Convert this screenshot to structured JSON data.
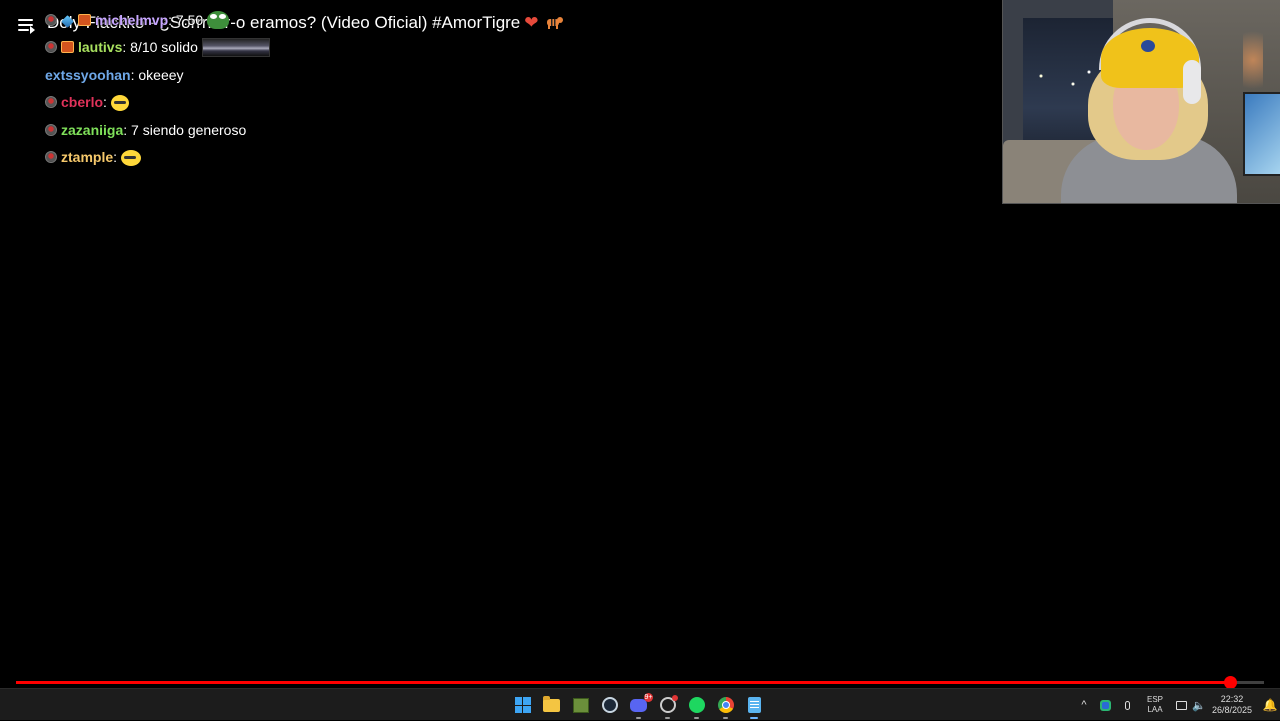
{
  "video": {
    "title": "Doly Flackko - ¿Sorrrrrrr-o eramos? (Video Oficial) #AmorTigre",
    "progress_percent": 97.3
  },
  "chat": [
    {
      "user": "michelmvp",
      "text": ": 7.50",
      "user_color": "#c7a6ff",
      "emote": "pepe-emote"
    },
    {
      "user": "lautivs",
      "text": ": 8/10 solido",
      "user_color": "#a8e05f",
      "emote": "car-emote"
    },
    {
      "user": "extssyoohan",
      "text": ": okeeey",
      "user_color": "#6fa8e8",
      "emote": ""
    },
    {
      "user": "cberlo",
      "text": ":",
      "user_color": "#e0325a",
      "emote": "yellow-face-emote"
    },
    {
      "user": "zazaniiga",
      "text": ": 7 siendo generoso",
      "user_color": "#7fe05a",
      "emote": ""
    },
    {
      "user": "ztample",
      "text": ":",
      "user_color": "#f5c86b",
      "emote": "yellow-face-emote"
    }
  ],
  "taskbar": {
    "discord_badge": "9+",
    "tray": {
      "lang_top": "ESP",
      "lang_bottom": "LAA",
      "time": "22:32",
      "date": "26/8/2025",
      "chevron": "^"
    }
  },
  "colors": {
    "progress": "#ff0000",
    "taskbar_bg": "#1c1c1c"
  }
}
